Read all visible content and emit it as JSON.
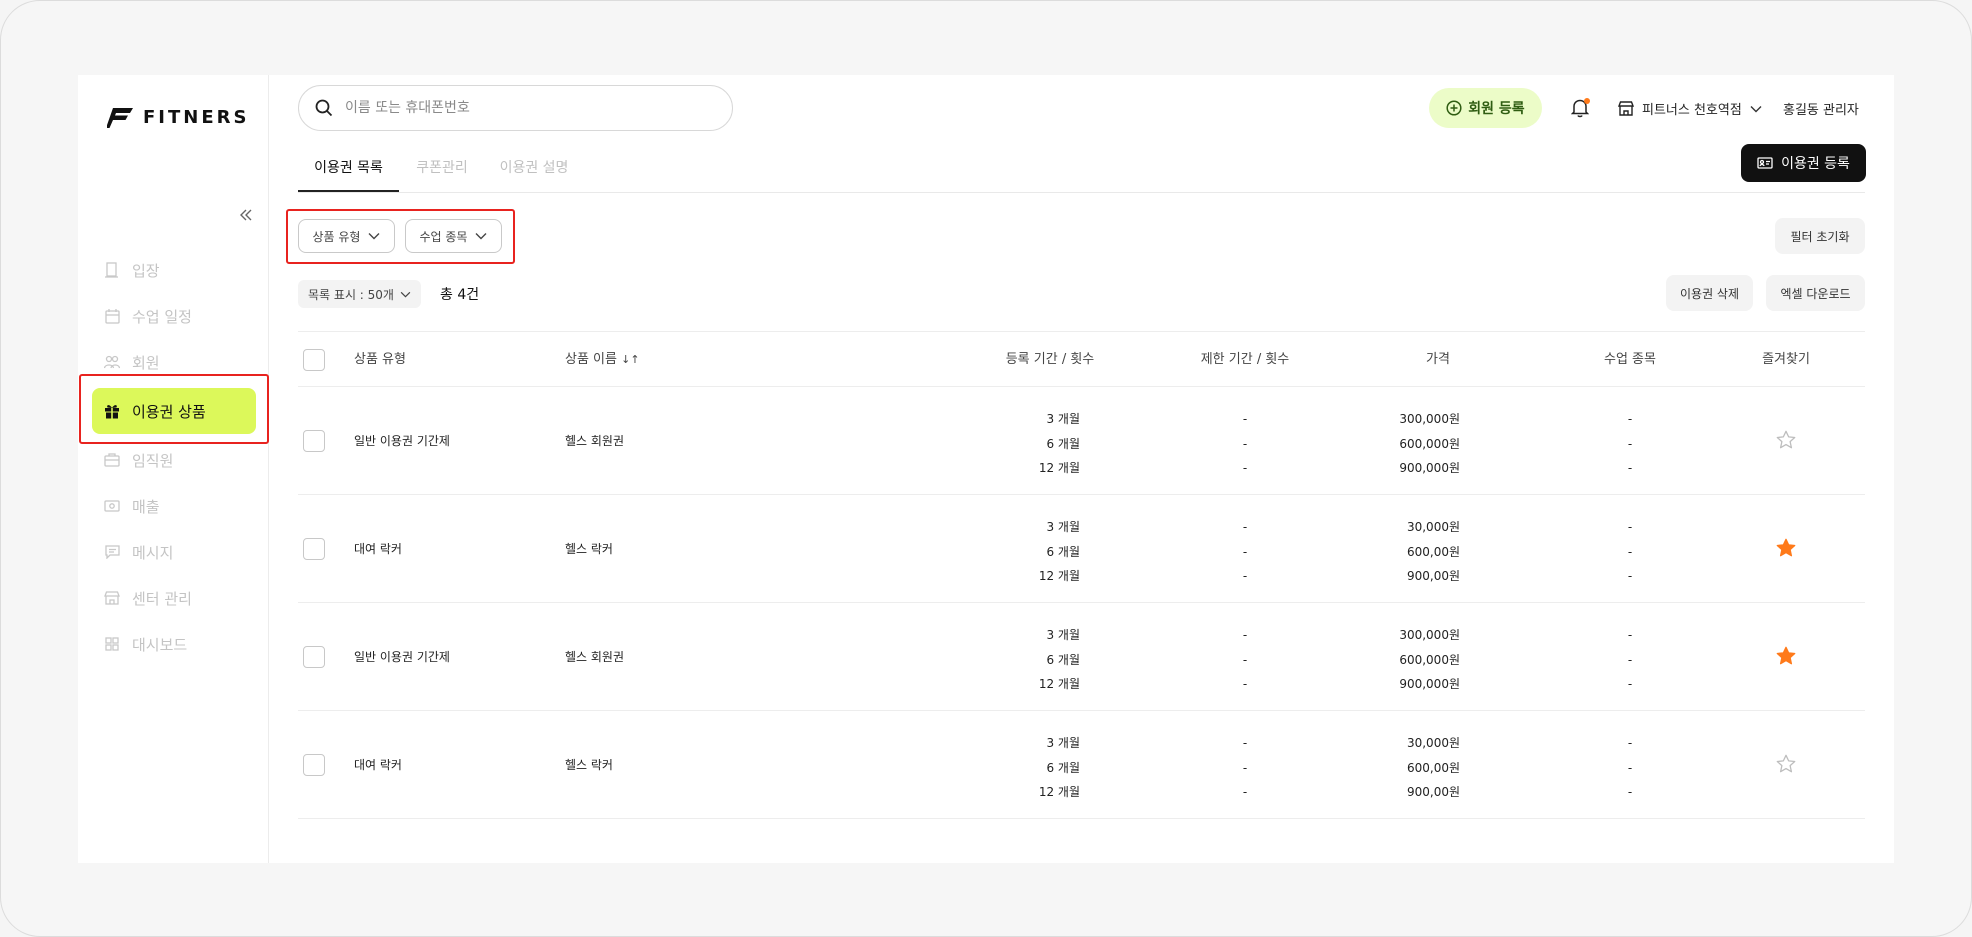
{
  "brand": {
    "name": "FITNERS"
  },
  "sidebar": {
    "collapse_icon": "chevrons-left-icon",
    "items": [
      {
        "label": "입장",
        "icon": "door-icon"
      },
      {
        "label": "수업 일정",
        "icon": "calendar-icon"
      },
      {
        "label": "회원",
        "icon": "users-icon"
      },
      {
        "label": "이용권 상품",
        "icon": "gift-icon",
        "active": true
      },
      {
        "label": "임직원",
        "icon": "briefcase-icon"
      },
      {
        "label": "매출",
        "icon": "cash-icon"
      },
      {
        "label": "메시지",
        "icon": "message-icon"
      },
      {
        "label": "센터 관리",
        "icon": "store-icon"
      },
      {
        "label": "대시보드",
        "icon": "grid-icon"
      }
    ]
  },
  "header": {
    "search_placeholder": "이름 또는 휴대폰번호",
    "register_member": "회원 등록",
    "store_name": "피트너스 천호역점",
    "admin_name": "홍길동 관리자"
  },
  "tabs": [
    {
      "label": "이용권 목록",
      "active": true
    },
    {
      "label": "쿠폰관리",
      "active": false
    },
    {
      "label": "이용권 설명",
      "active": false
    }
  ],
  "toolbar": {
    "register_ticket": "이용권 등록",
    "filter_product_type": "상품 유형",
    "filter_class_type": "수업 종목",
    "reset_filter": "필터 초기화",
    "list_size": "목록 표시 : 50개",
    "total": "총 4건",
    "delete_ticket": "이용권 삭제",
    "excel_download": "엑셀 다운로드"
  },
  "colors": {
    "accent": "#dcf85a",
    "star_on": "#ff7a1a",
    "highlight": "#e8231f"
  },
  "table": {
    "headers": {
      "product_type": "상품 유형",
      "product_name": "상품 이름",
      "period": "등록 기간 / 횟수",
      "limit": "제한 기간 / 횟수",
      "price": "가격",
      "class_type": "수업 종목",
      "favorite": "즐겨찾기"
    },
    "rows": [
      {
        "type": "일반 이용권 기간제",
        "name": "헬스 회원권",
        "periods": [
          "3 개월",
          "6 개월",
          "12 개월"
        ],
        "limits": [
          "-",
          "-",
          "-"
        ],
        "prices": [
          "300,000원",
          "600,000원",
          "900,000원"
        ],
        "classes": [
          "-",
          "-",
          "-"
        ],
        "favorite": false
      },
      {
        "type": "대여 락커",
        "name": "헬스 락커",
        "periods": [
          "3 개월",
          "6 개월",
          "12 개월"
        ],
        "limits": [
          "-",
          "-",
          "-"
        ],
        "prices": [
          "30,000원",
          "600,00원",
          "900,00원"
        ],
        "classes": [
          "-",
          "-",
          "-"
        ],
        "favorite": true
      },
      {
        "type": "일반 이용권 기간제",
        "name": "헬스 회원권",
        "periods": [
          "3 개월",
          "6 개월",
          "12 개월"
        ],
        "limits": [
          "-",
          "-",
          "-"
        ],
        "prices": [
          "300,000원",
          "600,000원",
          "900,000원"
        ],
        "classes": [
          "-",
          "-",
          "-"
        ],
        "favorite": true
      },
      {
        "type": "대여 락커",
        "name": "헬스 락커",
        "periods": [
          "3 개월",
          "6 개월",
          "12 개월"
        ],
        "limits": [
          "-",
          "-",
          "-"
        ],
        "prices": [
          "30,000원",
          "600,00원",
          "900,00원"
        ],
        "classes": [
          "-",
          "-",
          "-"
        ],
        "favorite": false
      }
    ]
  }
}
